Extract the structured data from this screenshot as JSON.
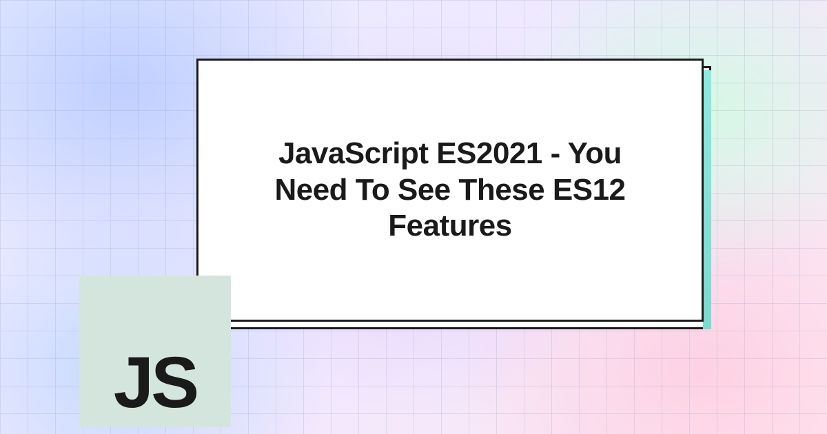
{
  "card": {
    "title": "JavaScript ES2021 - You Need To See These ES12 Features"
  },
  "badge": {
    "text": "JS"
  }
}
